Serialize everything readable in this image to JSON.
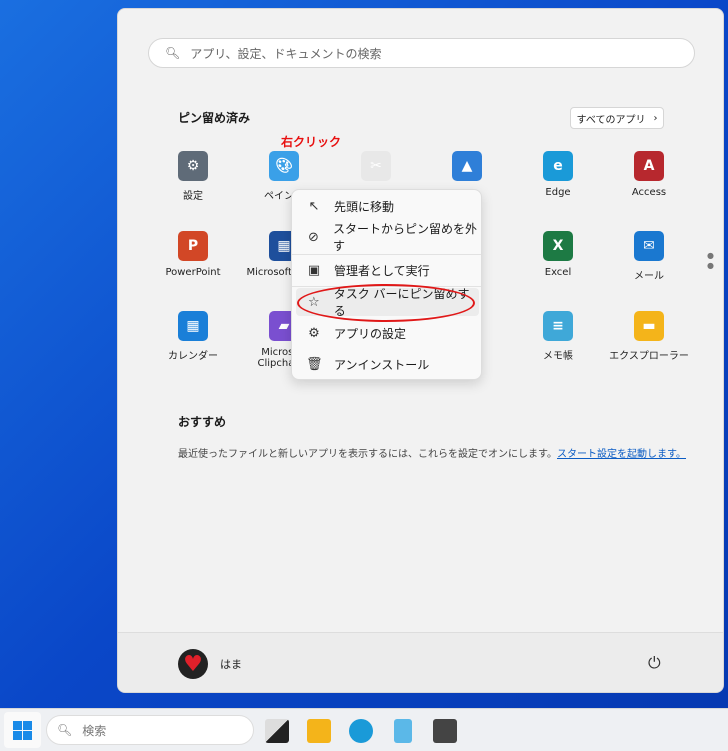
{
  "search": {
    "placeholder": "アプリ、設定、ドキュメントの検索"
  },
  "pinned": {
    "title": "ピン留め済み",
    "all_apps": "すべてのアプリ",
    "annotation": "右クリック",
    "apps": [
      {
        "label": "設定",
        "icon": "gear-icon",
        "color": "#5f6b78"
      },
      {
        "label": "ペイント",
        "icon": "paint-palette-icon",
        "color": "#3aa0e8"
      },
      {
        "label": "",
        "icon": "snipping-tool-icon",
        "color": "#e8e8e8"
      },
      {
        "label": "",
        "icon": "photos-icon",
        "color": "#2f7fd8"
      },
      {
        "label": "Edge",
        "icon": "edge-icon",
        "color": "#1a9ad8"
      },
      {
        "label": "Access",
        "icon": "access-icon",
        "color": "#b7282e"
      },
      {
        "label": "PowerPoint",
        "icon": "powerpoint-icon",
        "color": "#d24726"
      },
      {
        "label": "Microsoft Store",
        "icon": "store-icon",
        "color": "#1e4f9c"
      },
      {
        "label": "Excel",
        "icon": "excel-icon",
        "color": "#1d7a44"
      },
      {
        "label": "メール",
        "icon": "mail-icon",
        "color": "#1a78d0"
      },
      {
        "label": "カレンダー",
        "icon": "calendar-icon",
        "color": "#1a7fd8"
      },
      {
        "label": "Microsoft Clipchamp",
        "icon": "clipchamp-icon",
        "color": "#7a4fd0"
      },
      {
        "label": "メモ帳",
        "icon": "notepad-icon",
        "color": "#3fa8d8"
      },
      {
        "label": "エクスプローラー",
        "icon": "folder-icon",
        "color": "#f4b41a"
      }
    ]
  },
  "context_menu": [
    {
      "label": "先頭に移動",
      "icon": "arrow-up-left-icon"
    },
    {
      "label": "スタートからピン留めを外す",
      "icon": "unpin-icon"
    },
    {
      "label": "管理者として実行",
      "icon": "admin-shield-icon"
    },
    {
      "label": "タスク バーにピン留めする",
      "icon": "pin-icon",
      "highlighted": true
    },
    {
      "label": "アプリの設定",
      "icon": "gear-icon"
    },
    {
      "label": "アンインストール",
      "icon": "trash-icon"
    }
  ],
  "recommended": {
    "title": "おすすめ",
    "text": "最近使ったファイルと新しいアプリを表示するには、これらを設定でオンにします。",
    "link": "スタート設定を起動します。"
  },
  "user": {
    "name": "はま"
  },
  "taskbar": {
    "search_placeholder": "検索"
  }
}
